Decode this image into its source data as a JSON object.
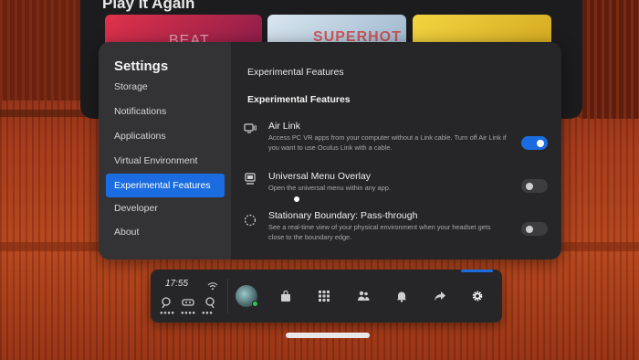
{
  "background": {
    "store_title": "Play It Again",
    "tiles": [
      {
        "label": "BEAT"
      },
      {
        "label": "SUPERHOT"
      },
      {
        "label": ""
      }
    ]
  },
  "settings": {
    "title": "Settings",
    "sidebar": {
      "items": [
        {
          "label": "Storage",
          "active": false
        },
        {
          "label": "Notifications",
          "active": false
        },
        {
          "label": "Applications",
          "active": false
        },
        {
          "label": "Virtual Environment",
          "active": false
        },
        {
          "label": "Experimental Features",
          "active": true
        },
        {
          "label": "Developer",
          "active": false
        },
        {
          "label": "About",
          "active": false
        }
      ]
    },
    "content": {
      "breadcrumb": "Experimental Features",
      "section_title": "Experimental Features",
      "rows": [
        {
          "icon": "air-link-icon",
          "title": "Air Link",
          "description": "Access PC VR apps from your computer without a Link cable. Turn off Air Link if you want to use Oculus Link with a cable.",
          "enabled": true
        },
        {
          "icon": "monitor-icon",
          "title": "Universal Menu Overlay",
          "description": "Open the universal menu within any app.",
          "enabled": false
        },
        {
          "icon": "boundary-icon",
          "title": "Stationary Boundary: Pass-through",
          "description": "See a real-time view of your physical environment when your headset gets close to the boundary edge.",
          "enabled": false
        }
      ]
    }
  },
  "menu_bar": {
    "time": "17:55",
    "icons": [
      "store-icon",
      "apps-icon",
      "people-icon",
      "notifications-icon",
      "share-icon",
      "settings-icon"
    ],
    "accent_color": "#1a6ce0",
    "status_color": "#2fc45a"
  },
  "colors": {
    "accent": "#1a6ce0",
    "panel": "#262628",
    "sidebar": "#333336"
  }
}
